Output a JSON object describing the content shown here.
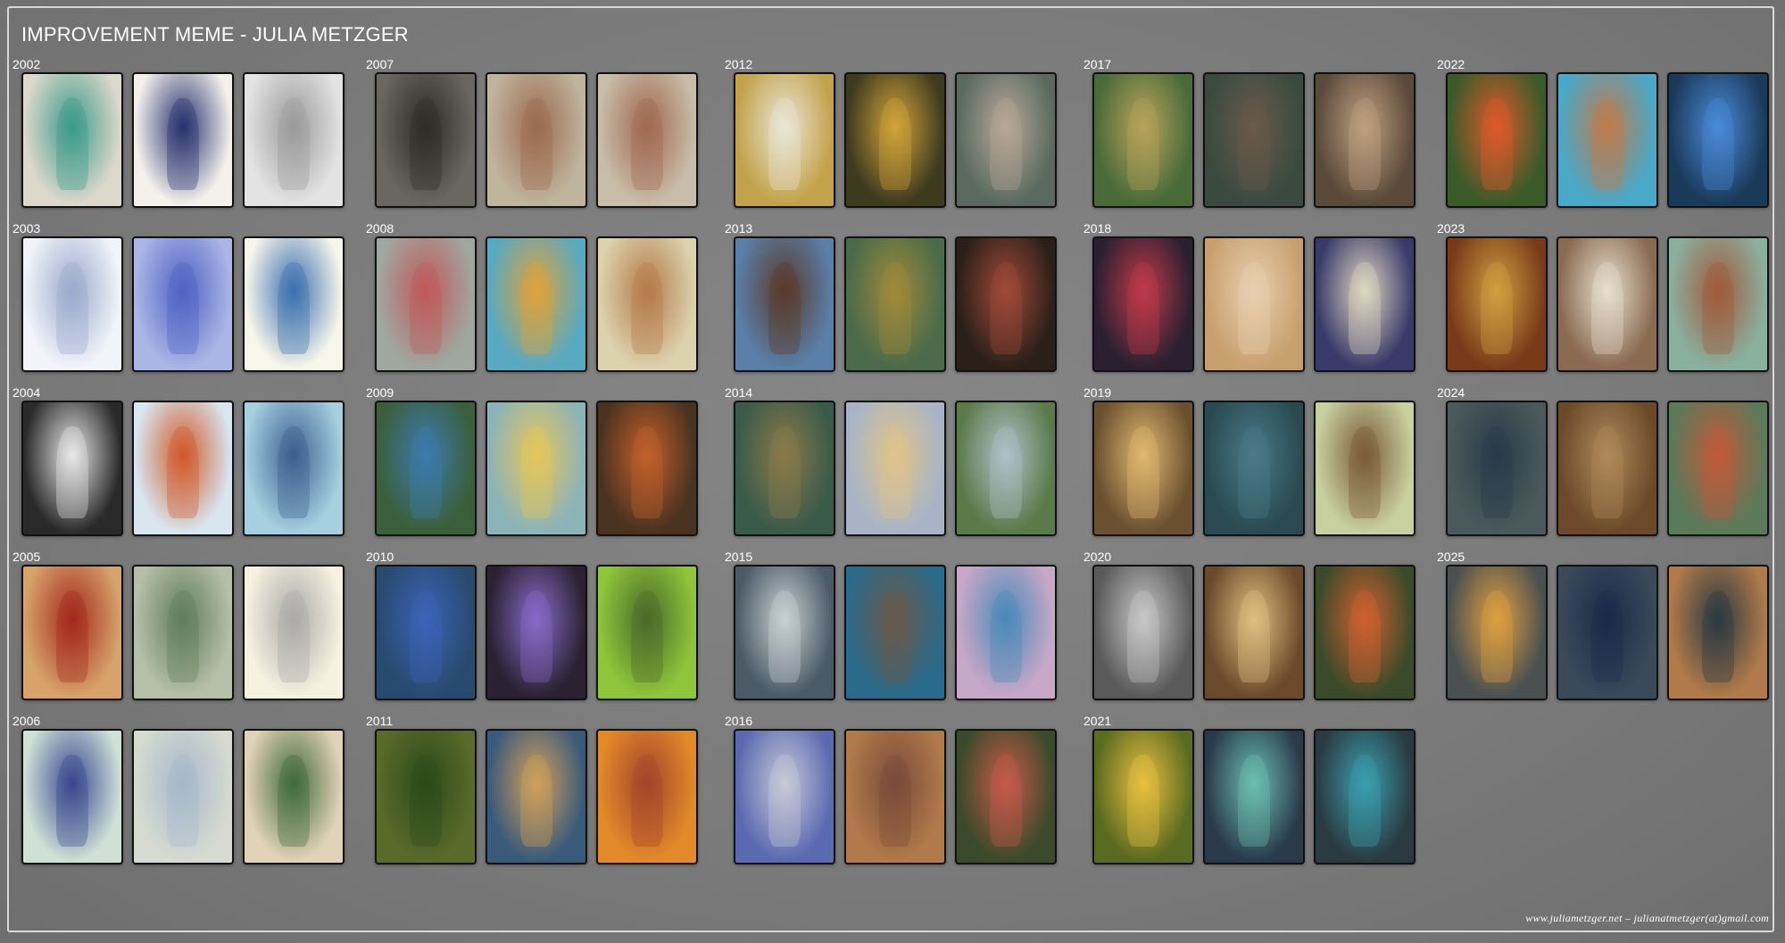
{
  "title": "IMPROVEMENT MEME - JULIA METZGER",
  "footer": "www.juliametzger.net  – julianatmetzger(at)gmail.com",
  "columns": [
    {
      "years": [
        {
          "year": "2002",
          "thumbs": [
            [
              "#dcd8cc",
              "#3a9b8a"
            ],
            [
              "#f4f1ec",
              "#27326e"
            ],
            [
              "#e3e3e3",
              "#9a9a9a"
            ]
          ]
        },
        {
          "year": "2003",
          "thumbs": [
            [
              "#f2f4fa",
              "#9aa9cc"
            ],
            [
              "#aab6e6",
              "#4f61c4"
            ],
            [
              "#f7f6ea",
              "#3a6fb0"
            ]
          ]
        },
        {
          "year": "2004",
          "thumbs": [
            [
              "#2a2a2a",
              "#e8e8e8"
            ],
            [
              "#d8e6f0",
              "#d05a2a"
            ],
            [
              "#a6cfe0",
              "#3d5f8f"
            ]
          ]
        },
        {
          "year": "2005",
          "thumbs": [
            [
              "#d7a36a",
              "#a3281e"
            ],
            [
              "#b7bfa8",
              "#5f7d5a"
            ],
            [
              "#f6f2e0",
              "#aaaaaa"
            ]
          ]
        },
        {
          "year": "2006",
          "thumbs": [
            [
              "#cfe0d6",
              "#38478f"
            ],
            [
              "#d6dad0",
              "#a6b8cc"
            ],
            [
              "#e2d3b8",
              "#3f6a3a"
            ]
          ]
        }
      ]
    },
    {
      "years": [
        {
          "year": "2007",
          "thumbs": [
            [
              "#6a6660",
              "#2e2b28"
            ],
            [
              "#bfb49c",
              "#9c6a50"
            ],
            [
              "#c8bda8",
              "#a06850"
            ]
          ]
        },
        {
          "year": "2008",
          "thumbs": [
            [
              "#9fa7a0",
              "#c05a5a"
            ],
            [
              "#58a9c2",
              "#e0a23a"
            ],
            [
              "#dcd2ad",
              "#b47a4a"
            ]
          ]
        },
        {
          "year": "2009",
          "thumbs": [
            [
              "#3b5f3a",
              "#3d7ab0"
            ],
            [
              "#8cb3b8",
              "#e6c75a"
            ],
            [
              "#4a3220",
              "#c2602a"
            ]
          ]
        },
        {
          "year": "2010",
          "thumbs": [
            [
              "#284a6e",
              "#3b63b8"
            ],
            [
              "#2a2232",
              "#8a6ac8"
            ],
            [
              "#8fc53a",
              "#4a6a2a"
            ]
          ]
        },
        {
          "year": "2011",
          "thumbs": [
            [
              "#5a6a2a",
              "#2a4a1a"
            ],
            [
              "#3a5a7a",
              "#d2a05a"
            ],
            [
              "#e28a2a",
              "#a4442a"
            ]
          ]
        }
      ]
    },
    {
      "years": [
        {
          "year": "2012",
          "thumbs": [
            [
              "#c2a24a",
              "#eae6d8"
            ],
            [
              "#3e3a1e",
              "#d2a43a"
            ],
            [
              "#5a6a60",
              "#b8a898"
            ]
          ]
        },
        {
          "year": "2013",
          "thumbs": [
            [
              "#5a7fa8",
              "#5a3a2a"
            ],
            [
              "#4a6a4a",
              "#a08a3a"
            ],
            [
              "#2a2018",
              "#a04a3a"
            ]
          ]
        },
        {
          "year": "2014",
          "thumbs": [
            [
              "#3a5a4a",
              "#8a7a4a"
            ],
            [
              "#a8b4c6",
              "#e0c48a"
            ],
            [
              "#5a7a4a",
              "#b0c0c8"
            ]
          ]
        },
        {
          "year": "2015",
          "thumbs": [
            [
              "#4a5a66",
              "#c8d0d4"
            ],
            [
              "#2a6a8a",
              "#6a5a4a"
            ],
            [
              "#c8a8c8",
              "#4a8ab8"
            ]
          ]
        },
        {
          "year": "2016",
          "thumbs": [
            [
              "#5a6ab0",
              "#c8c8d8"
            ],
            [
              "#b07a4a",
              "#7a4a3a"
            ],
            [
              "#3a4a2a",
              "#c85a4a"
            ]
          ]
        }
      ]
    },
    {
      "years": [
        {
          "year": "2017",
          "thumbs": [
            [
              "#4a6a3a",
              "#b8a45a"
            ],
            [
              "#3a4a40",
              "#6a5a4a"
            ],
            [
              "#5a4a3a",
              "#c0a080"
            ]
          ]
        },
        {
          "year": "2018",
          "thumbs": [
            [
              "#2a2030",
              "#c03a4a"
            ],
            [
              "#c8a070",
              "#e8d0b0"
            ],
            [
              "#3a3a6a",
              "#e0d8c0"
            ]
          ]
        },
        {
          "year": "2019",
          "thumbs": [
            [
              "#6a5030",
              "#e0b870"
            ],
            [
              "#2a4a50",
              "#4a7a8a"
            ],
            [
              "#c8d0a0",
              "#7a5a3a"
            ]
          ]
        },
        {
          "year": "2020",
          "thumbs": [
            [
              "#5a5a5a",
              "#c8c8c8"
            ],
            [
              "#6a4a2a",
              "#e0c080"
            ],
            [
              "#3a4a2a",
              "#d06030"
            ]
          ]
        },
        {
          "year": "2021",
          "thumbs": [
            [
              "#5a6a20",
              "#e8c040"
            ],
            [
              "#2a3a4a",
              "#6ac0b0"
            ],
            [
              "#2a3a40",
              "#3aa0b0"
            ]
          ]
        }
      ]
    },
    {
      "years": [
        {
          "year": "2022",
          "thumbs": [
            [
              "#3a5a2a",
              "#e05a2a"
            ],
            [
              "#4aa8c8",
              "#c07a4a"
            ],
            [
              "#1a3a5a",
              "#4a8ad8"
            ]
          ]
        },
        {
          "year": "2023",
          "thumbs": [
            [
              "#7a3a1a",
              "#d0a040"
            ],
            [
              "#8a6a50",
              "#e8e0d0"
            ],
            [
              "#8ab0a0",
              "#a05a3a"
            ]
          ]
        },
        {
          "year": "2024",
          "thumbs": [
            [
              "#4a5a5a",
              "#2a3a4a"
            ],
            [
              "#6a4a2a",
              "#b08a5a"
            ],
            [
              "#5a7a5a",
              "#c05a3a"
            ]
          ]
        },
        {
          "year": "2025",
          "thumbs": [
            [
              "#4a5050",
              "#e0a040"
            ],
            [
              "#3a4a5a",
              "#1a2a4a"
            ],
            [
              "#b07a4a",
              "#2a3a40"
            ]
          ]
        }
      ]
    }
  ]
}
